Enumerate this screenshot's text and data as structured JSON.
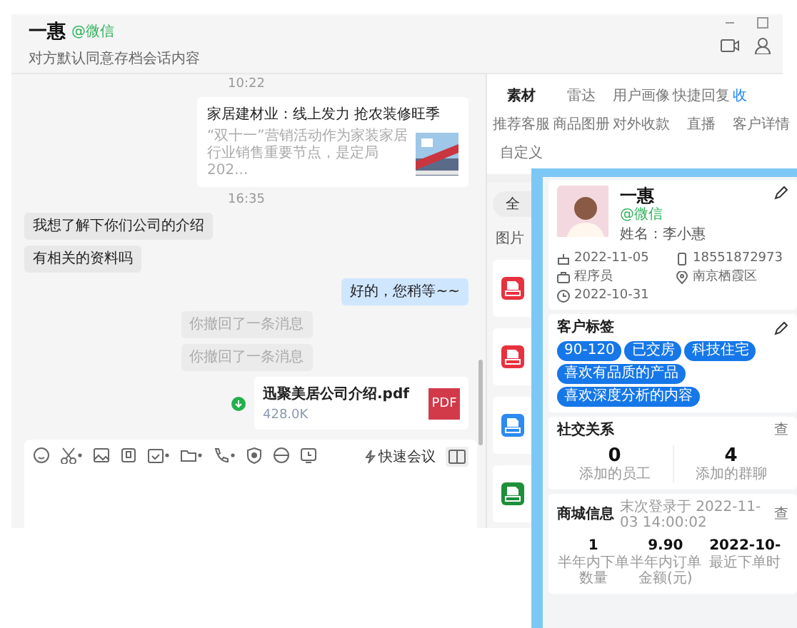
{
  "header": {
    "name": "一惠",
    "source": "@微信",
    "subtitle": "对方默认同意存档会话内容"
  },
  "messages": [
    {
      "kind": "time",
      "text": "10:22"
    },
    {
      "kind": "link",
      "title": "家居建材业：线上发力 抢农装修旺季",
      "description": "“双十一”营销活动作为家装家居行业销售重要节点，是定局202..."
    },
    {
      "kind": "time",
      "text": "16:35"
    },
    {
      "kind": "incoming",
      "text": "我想了解下你们公司的介绍"
    },
    {
      "kind": "incoming",
      "text": "有相关的资料吗"
    },
    {
      "kind": "outgoing",
      "text": "好的，您稍等~~"
    },
    {
      "kind": "system",
      "text": "你撤回了一条消息"
    },
    {
      "kind": "system",
      "text": "你撤回了一条消息"
    },
    {
      "kind": "file",
      "name": "迅聚美居公司介绍.pdf",
      "size": "428.0K",
      "badge": "PDF"
    }
  ],
  "composer": {
    "quick_meeting": "快速会议"
  },
  "side_tabs": [
    {
      "label": "素材",
      "kind": "tab",
      "selected": true
    },
    {
      "label": "雷达",
      "kind": "tab",
      "selected": false
    },
    {
      "label": "用户画像",
      "kind": "tab",
      "selected": false
    },
    {
      "label": "快捷回复",
      "kind": "tab",
      "selected": false
    },
    {
      "label": "收",
      "kind": "link",
      "selected": false
    },
    {
      "label": "推荐客服",
      "kind": "tab",
      "selected": false
    },
    {
      "label": "商品图册",
      "kind": "tab",
      "selected": false
    },
    {
      "label": "对外收款",
      "kind": "tab",
      "selected": false
    },
    {
      "label": "直播",
      "kind": "tab",
      "selected": false
    },
    {
      "label": "客户详情",
      "kind": "tab",
      "selected": false
    },
    {
      "label": "自定义",
      "kind": "tab",
      "selected": false
    }
  ],
  "material": {
    "filter": "全",
    "section": "图片",
    "files": [
      {
        "kind": "pdf"
      },
      {
        "kind": "pdf"
      },
      {
        "kind": "doc"
      },
      {
        "kind": "xls"
      }
    ]
  },
  "profile": {
    "name": "一惠",
    "source": "@微信",
    "real_name": "姓名：李小惠",
    "details": [
      {
        "kind": "birthday",
        "text": "2022-11-05"
      },
      {
        "kind": "phone",
        "text": "18551872973"
      },
      {
        "kind": "job",
        "text": "程序员"
      },
      {
        "kind": "location",
        "text": "南京栖霞区"
      },
      {
        "kind": "date",
        "text": "2022-10-31"
      }
    ],
    "tags_title": "客户标签",
    "tags": [
      "90-120",
      "已交房",
      "科技住宅",
      "喜欢有品质的产品",
      "喜欢深度分析的内容"
    ],
    "social": {
      "title": "社交关系",
      "link": "查",
      "stats": [
        {
          "value": "0",
          "label": "添加的员工"
        },
        {
          "value": "4",
          "label": "添加的群聊"
        }
      ]
    },
    "mall": {
      "title": "商城信息",
      "last_login": "末次登录于 2022-11-03 14:00:02",
      "link": "查",
      "stats": [
        {
          "value": "1",
          "label": "半年内下单数量"
        },
        {
          "value": "9.90",
          "label": "半年内订单金额(元)"
        },
        {
          "value": "2022-10-",
          "label": "最近下单时"
        }
      ]
    }
  }
}
